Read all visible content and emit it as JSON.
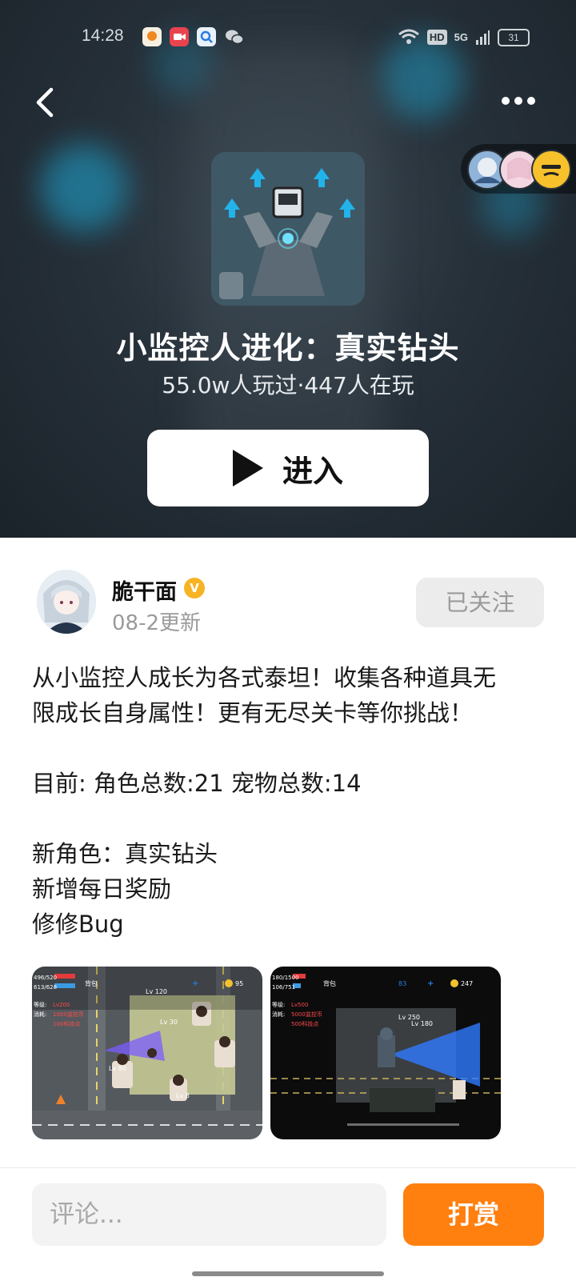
{
  "status_bar": {
    "time": "14:28",
    "indicators": [
      "wifi-icon",
      "HD",
      "5G",
      "signal-icon"
    ],
    "battery": "31"
  },
  "header": {
    "back_icon": "chevron-left-icon",
    "more_icon": "more-dots-icon"
  },
  "game": {
    "title": "小监控人进化：真实钻头",
    "stats": "55.0w人玩过·447人在玩",
    "enter_label": "进入"
  },
  "author": {
    "name": "脆干面",
    "badge": "V",
    "date": "08-2更新",
    "follow_label": "已关注"
  },
  "description": {
    "line1": "从小监控人成长为各式泰坦！收集各种道具无",
    "line2": "限成长自身属性！更有无尽关卡等你挑战！",
    "line3": "目前: 角色总数:21  宠物总数:14",
    "line4": "新角色：真实钻头",
    "line5": "新增每日奖励",
    "line6": "修修Bug"
  },
  "screenshots": {
    "shot1": {
      "hp": "496/520",
      "mp": "613/628",
      "bag": "背包",
      "gems": "+",
      "coins": "95",
      "level_label": "等级:",
      "level_value": "Lv200",
      "cost_label": "消耗:",
      "cost_value": "1000监控币",
      "cost_points": "100科技点",
      "lv_top": "Lv  120",
      "lv_a": "Lv 30",
      "lv_b": "Lv 80",
      "lv_c": "Lv 8"
    },
    "shot2": {
      "hp": "180/1500",
      "mp": "106/751",
      "bag": "背包",
      "gems": "83",
      "coins": "247",
      "level_label": "等级:",
      "level_value": "Lv500",
      "cost_label": "消耗:",
      "cost_value": "5000监控币",
      "cost_points": "500科技点",
      "lv_a": "Lv  250",
      "lv_b": "Lv  180"
    }
  },
  "bottom_bar": {
    "comment_placeholder": "评论...",
    "tip_label": "打赏"
  },
  "colors": {
    "accent": "#ff7f0f",
    "hero_bg": "#27313a",
    "badge": "#f7b323"
  }
}
